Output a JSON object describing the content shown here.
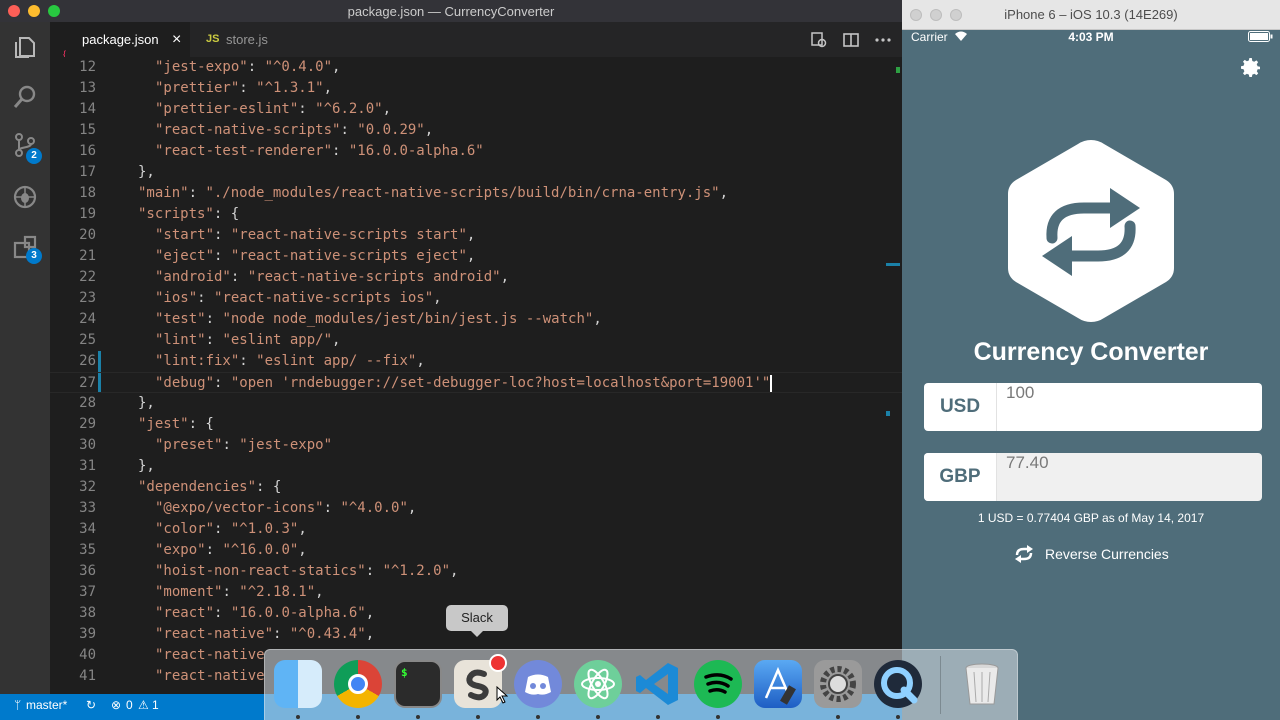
{
  "vscode": {
    "window_title": "package.json — CurrencyConverter",
    "tabs": [
      {
        "label": "package.json",
        "close": "×",
        "active": true
      },
      {
        "label": "store.js",
        "prefix": "JS",
        "active": false
      }
    ],
    "activity_badges": {
      "scm": "2",
      "extensions": "3"
    },
    "lines": [
      {
        "n": "12",
        "key": "\"jest-expo\"",
        "val": "\"^0.4.0\"",
        "tail": ",",
        "indent": 2
      },
      {
        "n": "13",
        "key": "\"prettier\"",
        "val": "\"^1.3.1\"",
        "tail": ",",
        "indent": 2
      },
      {
        "n": "14",
        "key": "\"prettier-eslint\"",
        "val": "\"^6.2.0\"",
        "tail": ",",
        "indent": 2
      },
      {
        "n": "15",
        "key": "\"react-native-scripts\"",
        "val": "\"0.0.29\"",
        "tail": ",",
        "indent": 2
      },
      {
        "n": "16",
        "key": "\"react-test-renderer\"",
        "val": "\"16.0.0-alpha.6\"",
        "tail": "",
        "indent": 2
      },
      {
        "n": "17",
        "plain": "},",
        "indent": 1
      },
      {
        "n": "18",
        "key": "\"main\"",
        "val": "\"./node_modules/react-native-scripts/build/bin/crna-entry.js\"",
        "tail": ",",
        "indent": 1
      },
      {
        "n": "19",
        "key": "\"scripts\"",
        "plaintail": ": {",
        "indent": 1
      },
      {
        "n": "20",
        "key": "\"start\"",
        "val": "\"react-native-scripts start\"",
        "tail": ",",
        "indent": 2
      },
      {
        "n": "21",
        "key": "\"eject\"",
        "val": "\"react-native-scripts eject\"",
        "tail": ",",
        "indent": 2
      },
      {
        "n": "22",
        "key": "\"android\"",
        "val": "\"react-native-scripts android\"",
        "tail": ",",
        "indent": 2
      },
      {
        "n": "23",
        "key": "\"ios\"",
        "val": "\"react-native-scripts ios\"",
        "tail": ",",
        "indent": 2
      },
      {
        "n": "24",
        "key": "\"test\"",
        "val": "\"node node_modules/jest/bin/jest.js --watch\"",
        "tail": ",",
        "indent": 2
      },
      {
        "n": "25",
        "key": "\"lint\"",
        "val": "\"eslint app/\"",
        "tail": ",",
        "indent": 2
      },
      {
        "n": "26",
        "key": "\"lint:fix\"",
        "val": "\"eslint app/ --fix\"",
        "tail": ",",
        "indent": 2
      },
      {
        "n": "27",
        "key": "\"debug\"",
        "val": "\"open 'rndebugger://set-debugger-loc?host=localhost&port=19001'\"",
        "tail": "",
        "indent": 2,
        "current": true
      },
      {
        "n": "28",
        "plain": "},",
        "indent": 1
      },
      {
        "n": "29",
        "key": "\"jest\"",
        "plaintail": ": {",
        "indent": 1
      },
      {
        "n": "30",
        "key": "\"preset\"",
        "val": "\"jest-expo\"",
        "tail": "",
        "indent": 2
      },
      {
        "n": "31",
        "plain": "},",
        "indent": 1
      },
      {
        "n": "32",
        "key": "\"dependencies\"",
        "plaintail": ": {",
        "indent": 1
      },
      {
        "n": "33",
        "key": "\"@expo/vector-icons\"",
        "val": "\"^4.0.0\"",
        "tail": ",",
        "indent": 2
      },
      {
        "n": "34",
        "key": "\"color\"",
        "val": "\"^1.0.3\"",
        "tail": ",",
        "indent": 2
      },
      {
        "n": "35",
        "key": "\"expo\"",
        "val": "\"^16.0.0\"",
        "tail": ",",
        "indent": 2
      },
      {
        "n": "36",
        "key": "\"hoist-non-react-statics\"",
        "val": "\"^1.2.0\"",
        "tail": ",",
        "indent": 2
      },
      {
        "n": "37",
        "key": "\"moment\"",
        "val": "\"^2.18.1\"",
        "tail": ",",
        "indent": 2
      },
      {
        "n": "38",
        "key": "\"react\"",
        "val": "\"16.0.0-alpha.6\"",
        "tail": ",",
        "indent": 2
      },
      {
        "n": "39",
        "key": "\"react-native\"",
        "val": "\"^0.43.4\"",
        "tail": ",",
        "indent": 2
      },
      {
        "n": "40",
        "key": "\"react-native",
        "val": "",
        "tail": "",
        "indent": 2
      },
      {
        "n": "41",
        "key": "\"react-native",
        "val": "",
        "tail": "",
        "indent": 2
      }
    ],
    "status": {
      "branch": "master*",
      "errors": "0",
      "warnings": "1"
    }
  },
  "simulator": {
    "window_title": "iPhone 6 – iOS 10.3 (14E269)",
    "carrier": "Carrier",
    "time": "4:03 PM",
    "app_title": "Currency Converter",
    "base_currency": "USD",
    "base_value": "100",
    "quote_currency": "GBP",
    "quote_value": "77.40",
    "rate_text": "1 USD = 0.77404 GBP as of May 14, 2017",
    "reverse_label": "Reverse Currencies"
  },
  "dock": {
    "tooltip": "Slack",
    "apps": [
      "finder-icon",
      "chrome-icon",
      "terminal-icon",
      "slack-icon",
      "discord-icon",
      "atom-icon",
      "vscode-icon",
      "spotify-icon",
      "xcode-icon",
      "system-preferences-icon",
      "quicktime-icon",
      "trash-icon"
    ],
    "terminal_glyph": "$"
  },
  "colors": {
    "accent": "#007acc",
    "sim_bg": "#4f6d7a"
  }
}
